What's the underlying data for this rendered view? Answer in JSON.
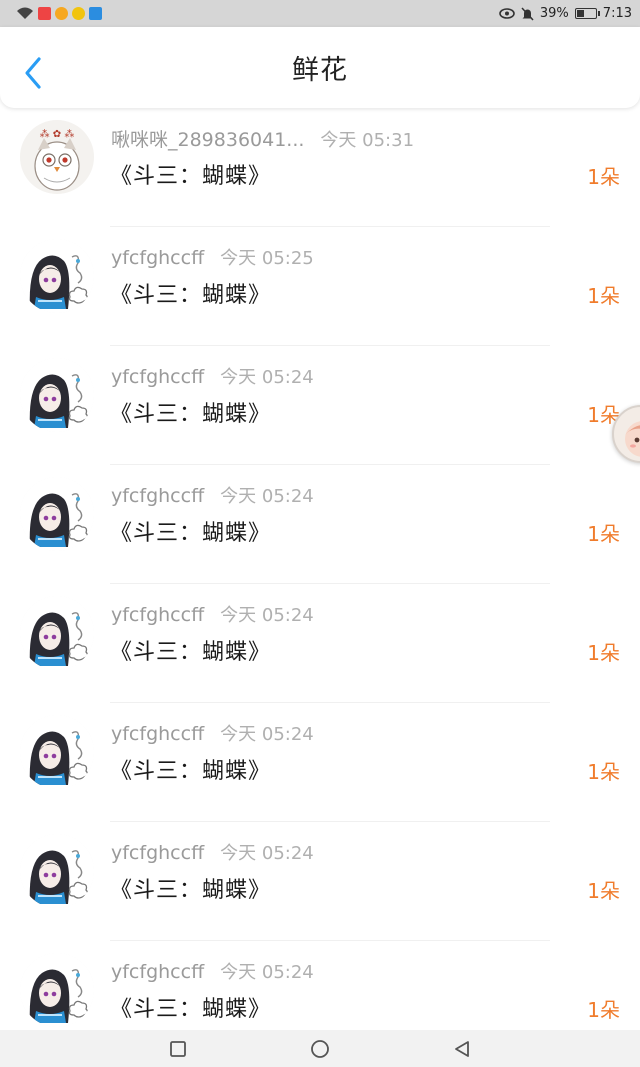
{
  "status_bar": {
    "battery": "39%",
    "battery_level": 0.39,
    "time": "7:13",
    "icons": [
      "wifi-icon",
      "app-icon-red",
      "weibo-icon",
      "app-icon-yellow",
      "app-icon-blue",
      "eye-icon",
      "mute-icon",
      "battery-icon"
    ]
  },
  "header": {
    "title": "鲜花",
    "back_icon": "chevron-left-icon"
  },
  "colors": {
    "accent_blue": "#2a9df4",
    "count_orange": "#f07c2c",
    "meta_gray": "#9a9a9a"
  },
  "items": [
    {
      "name": "啾咪咪_289836041...",
      "time": "今天 05:31",
      "gift": "《斗三：蝴蝶》",
      "count": "1朵",
      "avatar": "owl"
    },
    {
      "name": "yfcfghccff",
      "time": "今天 05:25",
      "gift": "《斗三：蝴蝶》",
      "count": "1朵",
      "avatar": "girl"
    },
    {
      "name": "yfcfghccff",
      "time": "今天 05:24",
      "gift": "《斗三：蝴蝶》",
      "count": "1朵",
      "avatar": "girl"
    },
    {
      "name": "yfcfghccff",
      "time": "今天 05:24",
      "gift": "《斗三：蝴蝶》",
      "count": "1朵",
      "avatar": "girl"
    },
    {
      "name": "yfcfghccff",
      "time": "今天 05:24",
      "gift": "《斗三：蝴蝶》",
      "count": "1朵",
      "avatar": "girl"
    },
    {
      "name": "yfcfghccff",
      "time": "今天 05:24",
      "gift": "《斗三：蝴蝶》",
      "count": "1朵",
      "avatar": "girl"
    },
    {
      "name": "yfcfghccff",
      "time": "今天 05:24",
      "gift": "《斗三：蝴蝶》",
      "count": "1朵",
      "avatar": "girl"
    },
    {
      "name": "yfcfghccff",
      "time": "今天 05:24",
      "gift": "《斗三：蝴蝶》",
      "count": "1朵",
      "avatar": "girl"
    }
  ],
  "nav": {
    "icons": [
      "recent-apps-icon",
      "home-icon",
      "back-icon"
    ]
  }
}
